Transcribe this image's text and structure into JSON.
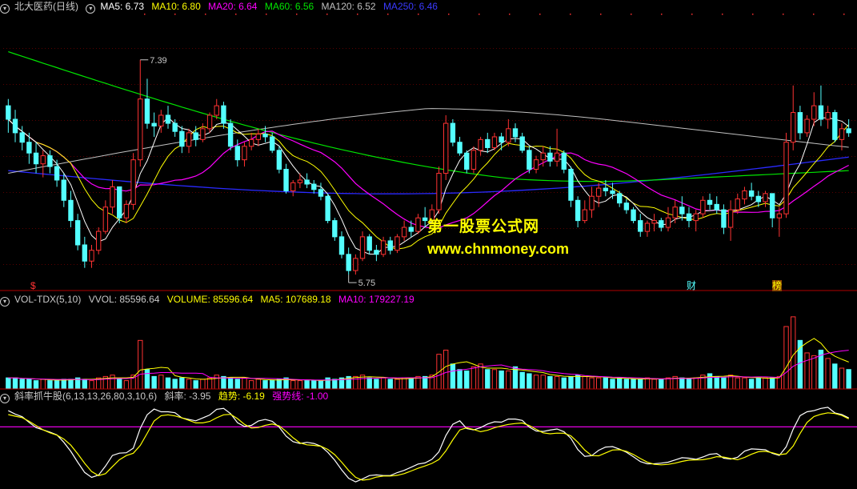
{
  "header": {
    "stock_name": "北大医药(日线)",
    "ma5_label": "MA5: 6.73",
    "ma10_label": "MA10: 6.80",
    "ma20_label": "MA20: 6.64",
    "ma60_label": "MA60: 6.56",
    "ma120_label": "MA120: 6.52",
    "ma250_label": "MA250: 6.46"
  },
  "volume_header": {
    "name": "VOL-TDX(5,10)",
    "vvol_label": "VVOL: 85596.64",
    "volume_label": "VOLUME: 85596.64",
    "ma5_label": "MA5: 107689.18",
    "ma10_label": "MA10: 179227.19"
  },
  "indicator_header": {
    "name": "斜率抓牛股(6,13,13,26,80,3,10,6)",
    "slope_label": "斜率: -3.95",
    "trend_label": "趋势: -6.19",
    "strong_label": "强势线: -1.00"
  },
  "annotations": {
    "high": "7.39",
    "low": "5.75"
  },
  "markers": {
    "s": "$",
    "cai": "财",
    "bang": "榜"
  },
  "watermark": {
    "line1": "第一股票公式网",
    "line2": "www.chnmoney.com"
  },
  "colors": {
    "bg": "#000000",
    "up": "#ff3232",
    "down": "#54ffff",
    "ma5": "#ffffff",
    "ma10": "#ffff00",
    "ma20": "#ff00ff",
    "ma60": "#00e600",
    "ma120": "#c0c0c0",
    "ma250": "#2a2aff",
    "separator": "#b00000",
    "dots": "#ff3232"
  },
  "chart_data": {
    "type": "candlestick",
    "y_range": [
      5.7,
      7.75
    ],
    "ohlc": [
      [
        7.05,
        7.1,
        6.85,
        6.95
      ],
      [
        6.95,
        7.02,
        6.78,
        6.85
      ],
      [
        6.85,
        6.9,
        6.72,
        6.78
      ],
      [
        6.78,
        6.85,
        6.62,
        6.7
      ],
      [
        6.7,
        6.78,
        6.55,
        6.62
      ],
      [
        6.62,
        6.72,
        6.52,
        6.68
      ],
      [
        6.68,
        6.72,
        6.55,
        6.6
      ],
      [
        6.6,
        6.65,
        6.45,
        6.5
      ],
      [
        6.5,
        6.55,
        6.3,
        6.35
      ],
      [
        6.35,
        6.42,
        6.15,
        6.2
      ],
      [
        6.2,
        6.25,
        5.98,
        6.02
      ],
      [
        6.02,
        6.08,
        5.85,
        5.9
      ],
      [
        5.9,
        6.02,
        5.85,
        5.98
      ],
      [
        5.98,
        6.15,
        5.95,
        6.12
      ],
      [
        6.12,
        6.35,
        6.1,
        6.3
      ],
      [
        6.3,
        6.5,
        6.25,
        6.45
      ],
      [
        6.45,
        6.42,
        6.18,
        6.22
      ],
      [
        6.22,
        6.35,
        6.18,
        6.32
      ],
      [
        6.32,
        6.7,
        6.28,
        6.65
      ],
      [
        6.65,
        7.39,
        6.6,
        7.1
      ],
      [
        7.1,
        7.25,
        6.88,
        6.92
      ],
      [
        6.92,
        7.0,
        6.82,
        6.9
      ],
      [
        6.9,
        7.02,
        6.85,
        6.98
      ],
      [
        6.98,
        7.05,
        6.88,
        6.92
      ],
      [
        6.92,
        6.95,
        6.82,
        6.86
      ],
      [
        6.86,
        6.9,
        6.7,
        6.75
      ],
      [
        6.75,
        6.88,
        6.7,
        6.85
      ],
      [
        6.85,
        6.9,
        6.75,
        6.8
      ],
      [
        6.8,
        6.92,
        6.78,
        6.88
      ],
      [
        6.88,
        7.0,
        6.85,
        6.98
      ],
      [
        6.98,
        7.1,
        6.95,
        7.05
      ],
      [
        7.05,
        7.08,
        6.88,
        6.92
      ],
      [
        6.92,
        6.95,
        6.72,
        6.75
      ],
      [
        6.75,
        6.8,
        6.6,
        6.65
      ],
      [
        6.65,
        6.78,
        6.6,
        6.75
      ],
      [
        6.75,
        6.85,
        6.72,
        6.8
      ],
      [
        6.8,
        6.88,
        6.75,
        6.84
      ],
      [
        6.84,
        6.9,
        6.78,
        6.82
      ],
      [
        6.82,
        6.85,
        6.7,
        6.72
      ],
      [
        6.72,
        6.75,
        6.55,
        6.58
      ],
      [
        6.58,
        6.62,
        6.4,
        6.42
      ],
      [
        6.42,
        6.5,
        6.38,
        6.48
      ],
      [
        6.48,
        6.55,
        6.44,
        6.5
      ],
      [
        6.5,
        6.55,
        6.44,
        6.47
      ],
      [
        6.47,
        6.5,
        6.4,
        6.43
      ],
      [
        6.43,
        6.48,
        6.35,
        6.38
      ],
      [
        6.38,
        6.4,
        6.18,
        6.2
      ],
      [
        6.2,
        6.22,
        6.05,
        6.08
      ],
      [
        6.08,
        6.12,
        5.92,
        5.95
      ],
      [
        5.95,
        6.0,
        5.8,
        5.83
      ],
      [
        5.83,
        5.95,
        5.8,
        5.92
      ],
      [
        5.92,
        6.12,
        5.9,
        6.08
      ],
      [
        6.08,
        6.1,
        5.95,
        5.98
      ],
      [
        5.98,
        6.02,
        5.9,
        5.95
      ],
      [
        5.95,
        6.08,
        5.93,
        6.05
      ],
      [
        6.05,
        6.08,
        5.95,
        5.98
      ],
      [
        5.98,
        6.1,
        5.96,
        6.08
      ],
      [
        6.08,
        6.2,
        6.05,
        6.15
      ],
      [
        6.15,
        6.2,
        6.08,
        6.12
      ],
      [
        6.12,
        6.25,
        6.1,
        6.22
      ],
      [
        6.22,
        6.3,
        6.15,
        6.2
      ],
      [
        6.2,
        6.32,
        6.18,
        6.28
      ],
      [
        6.28,
        6.6,
        6.25,
        6.55
      ],
      [
        6.55,
        6.98,
        6.5,
        6.92
      ],
      [
        6.92,
        6.95,
        6.75,
        6.78
      ],
      [
        6.78,
        6.82,
        6.68,
        6.7
      ],
      [
        6.7,
        6.72,
        6.55,
        6.58
      ],
      [
        6.58,
        6.75,
        6.55,
        6.72
      ],
      [
        6.72,
        6.82,
        6.68,
        6.8
      ],
      [
        6.8,
        6.85,
        6.7,
        6.74
      ],
      [
        6.74,
        6.85,
        6.72,
        6.82
      ],
      [
        6.82,
        6.85,
        6.72,
        6.78
      ],
      [
        6.78,
        6.95,
        6.75,
        6.88
      ],
      [
        6.88,
        6.92,
        6.78,
        6.82
      ],
      [
        6.82,
        6.85,
        6.7,
        6.72
      ],
      [
        6.72,
        6.75,
        6.55,
        6.58
      ],
      [
        6.58,
        6.68,
        6.55,
        6.65
      ],
      [
        6.65,
        6.75,
        6.6,
        6.7
      ],
      [
        6.7,
        6.75,
        6.6,
        6.64
      ],
      [
        6.64,
        6.88,
        6.6,
        6.7
      ],
      [
        6.7,
        6.72,
        6.55,
        6.58
      ],
      [
        6.58,
        6.6,
        6.3,
        6.35
      ],
      [
        6.35,
        6.38,
        6.15,
        6.2
      ],
      [
        6.2,
        6.35,
        6.18,
        6.28
      ],
      [
        6.28,
        6.45,
        6.22,
        6.38
      ],
      [
        6.38,
        6.48,
        6.3,
        6.44
      ],
      [
        6.44,
        6.5,
        6.38,
        6.42
      ],
      [
        6.42,
        6.48,
        6.36,
        6.4
      ],
      [
        6.4,
        6.42,
        6.3,
        6.33
      ],
      [
        6.33,
        6.36,
        6.25,
        6.28
      ],
      [
        6.28,
        6.3,
        6.18,
        6.2
      ],
      [
        6.2,
        6.25,
        6.08,
        6.12
      ],
      [
        6.12,
        6.2,
        6.08,
        6.18
      ],
      [
        6.18,
        6.25,
        6.12,
        6.2
      ],
      [
        6.2,
        6.22,
        6.12,
        6.15
      ],
      [
        6.15,
        6.3,
        6.12,
        6.22
      ],
      [
        6.22,
        6.35,
        6.18,
        6.3
      ],
      [
        6.3,
        6.38,
        6.2,
        6.25
      ],
      [
        6.25,
        6.3,
        6.15,
        6.2
      ],
      [
        6.2,
        6.28,
        6.12,
        6.25
      ],
      [
        6.25,
        6.38,
        6.22,
        6.35
      ],
      [
        6.35,
        6.4,
        6.28,
        6.32
      ],
      [
        6.32,
        6.38,
        6.25,
        6.28
      ],
      [
        6.28,
        6.32,
        6.1,
        6.15
      ],
      [
        6.15,
        6.35,
        6.05,
        6.28
      ],
      [
        6.28,
        6.4,
        6.25,
        6.36
      ],
      [
        6.36,
        6.45,
        6.32,
        6.42
      ],
      [
        6.42,
        6.48,
        6.35,
        6.38
      ],
      [
        6.38,
        6.42,
        6.3,
        6.34
      ],
      [
        6.34,
        6.42,
        6.3,
        6.4
      ],
      [
        6.4,
        6.4,
        6.15,
        6.22
      ],
      [
        6.22,
        6.3,
        6.08,
        6.25
      ],
      [
        6.25,
        6.85,
        6.22,
        6.78
      ],
      [
        6.78,
        7.2,
        6.72,
        7.0
      ],
      [
        7.0,
        7.05,
        6.8,
        6.85
      ],
      [
        6.85,
        6.98,
        6.82,
        6.95
      ],
      [
        6.95,
        7.15,
        6.9,
        7.05
      ],
      [
        7.05,
        7.2,
        6.9,
        6.95
      ],
      [
        6.95,
        7.05,
        6.88,
        7.0
      ],
      [
        7.0,
        7.02,
        6.78,
        6.8
      ],
      [
        6.8,
        6.92,
        6.72,
        6.88
      ],
      [
        6.88,
        6.95,
        6.82,
        6.85
      ]
    ],
    "volume_y_max": 60,
    "volume": [
      8,
      8,
      7,
      7,
      6,
      7,
      6,
      6,
      7,
      7,
      8,
      7,
      6,
      8,
      9,
      10,
      7,
      6,
      10,
      35,
      14,
      9,
      10,
      8,
      7,
      8,
      7,
      6,
      7,
      8,
      10,
      9,
      8,
      7,
      8,
      6,
      7,
      6,
      6,
      7,
      8,
      6,
      6,
      6,
      6,
      6,
      8,
      7,
      8,
      9,
      9,
      10,
      8,
      7,
      8,
      7,
      7,
      8,
      8,
      9,
      9,
      10,
      25,
      28,
      18,
      14,
      13,
      16,
      18,
      14,
      14,
      13,
      13,
      16,
      12,
      11,
      10,
      10,
      9,
      9,
      8,
      9,
      10,
      9,
      8,
      8,
      8,
      7,
      8,
      7,
      7,
      7,
      8,
      7,
      7,
      8,
      9,
      8,
      7,
      8,
      10,
      11,
      9,
      8,
      10,
      8,
      8,
      7,
      8,
      8,
      8,
      9,
      45,
      52,
      35,
      26,
      24,
      28,
      22,
      18,
      15,
      14
    ]
  }
}
